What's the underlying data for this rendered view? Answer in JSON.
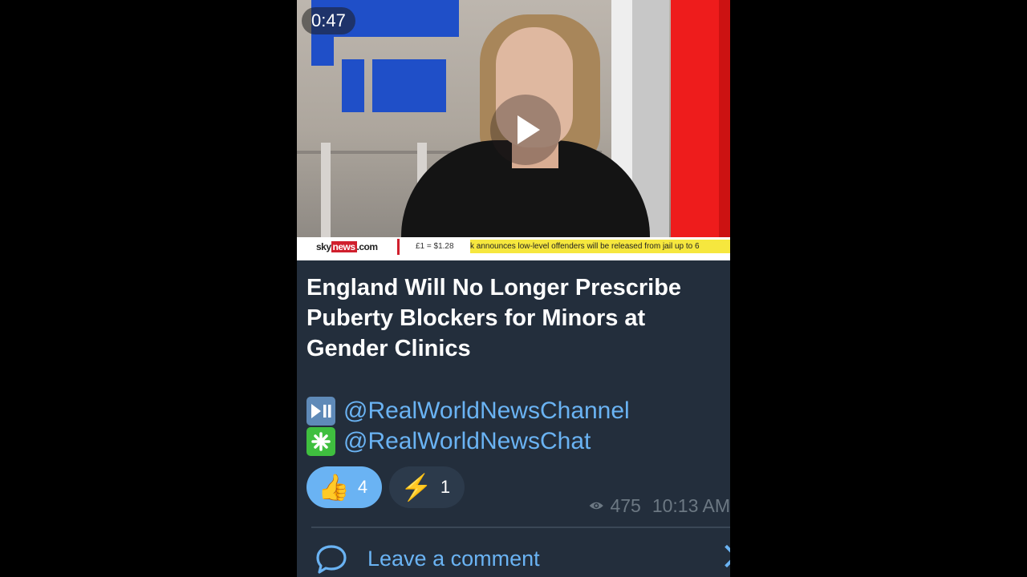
{
  "video": {
    "duration": "0:47",
    "ticker_logo_sky": "sky",
    "ticker_logo_news": "news",
    "ticker_logo_com": ".com",
    "ticker_rate": "£1 = $1.28",
    "ticker_headline": "k announces low-level offenders will be released from jail up to 6"
  },
  "post": {
    "title": "England Will No Longer Prescribe Puberty Blockers for Minors at Gender Clinics",
    "links": [
      {
        "icon": "play-pause-icon",
        "text": "@RealWorldNewsChannel"
      },
      {
        "icon": "asterisk-icon",
        "text": "@RealWorldNewsChat"
      }
    ]
  },
  "reactions": [
    {
      "emoji": "👍",
      "count": "4"
    },
    {
      "emoji": "⚡",
      "count": "1"
    }
  ],
  "meta": {
    "views": "475",
    "time": "10:13 AM"
  },
  "comment": {
    "label": "Leave a comment"
  },
  "colors": {
    "background": "#000000",
    "message_bg": "#232e3c",
    "link": "#6ab3f3",
    "meta": "#6c7883"
  }
}
